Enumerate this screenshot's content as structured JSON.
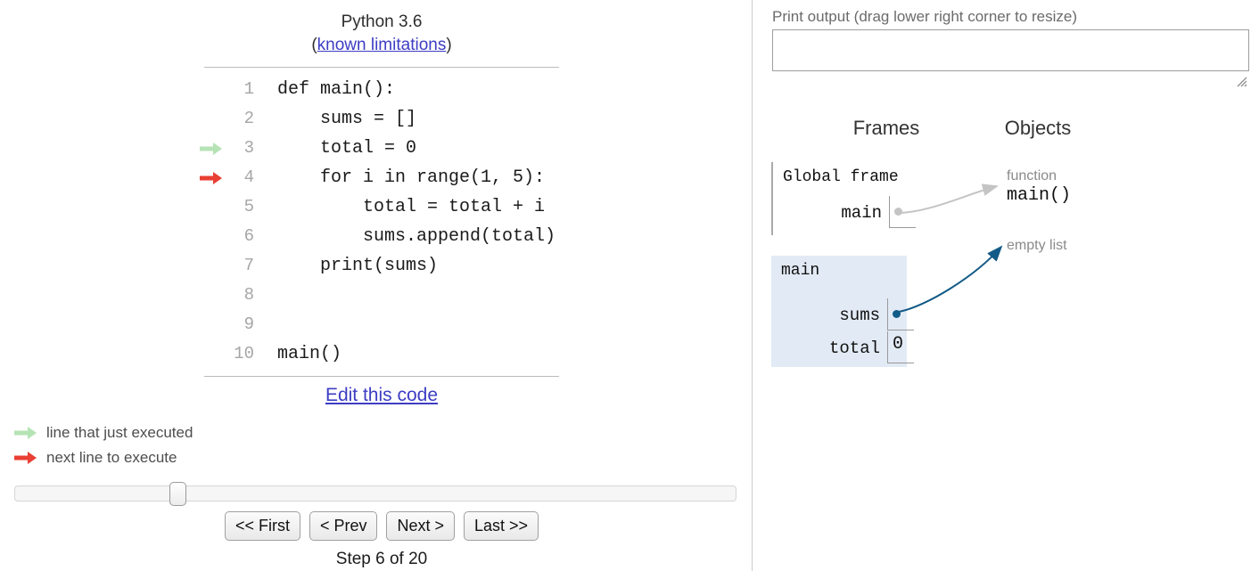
{
  "left": {
    "python_version": "Python 3.6",
    "known_limitations_prefix": "(",
    "known_limitations_link": "known limitations",
    "known_limitations_suffix": ")",
    "code_lines": [
      {
        "num": "1",
        "text": "def main():",
        "marker": "none"
      },
      {
        "num": "2",
        "text": "    sums = []",
        "marker": "none"
      },
      {
        "num": "3",
        "text": "    total = 0",
        "marker": "green"
      },
      {
        "num": "4",
        "text": "    for i in range(1, 5):",
        "marker": "red"
      },
      {
        "num": "5",
        "text": "        total = total + i",
        "marker": "none"
      },
      {
        "num": "6",
        "text": "        sums.append(total)",
        "marker": "none"
      },
      {
        "num": "7",
        "text": "    print(sums)",
        "marker": "none"
      },
      {
        "num": "8",
        "text": "",
        "marker": "none"
      },
      {
        "num": "9",
        "text": "",
        "marker": "none"
      },
      {
        "num": "10",
        "text": "main()",
        "marker": "none"
      }
    ],
    "edit_link": "Edit this code",
    "legend": [
      {
        "icon": "green-arrow-icon",
        "label": "line that just executed"
      },
      {
        "icon": "red-arrow-icon",
        "label": "next line to execute"
      }
    ],
    "nav_buttons": [
      {
        "name": "first",
        "label": "<< First"
      },
      {
        "name": "prev",
        "label": "< Prev"
      },
      {
        "name": "next",
        "label": "Next >"
      },
      {
        "name": "last",
        "label": "Last >>"
      }
    ],
    "step_label": "Step 6 of 20",
    "slider": {
      "value": 6,
      "min": 1,
      "max": 20,
      "percent": 22
    }
  },
  "right": {
    "print_output_label": "Print output (drag lower right corner to resize)",
    "print_output_value": "",
    "frames_header": "Frames",
    "objects_header": "Objects",
    "frames": [
      {
        "title": "Global frame",
        "highlighted": false,
        "vars": [
          {
            "name": "main",
            "value": "",
            "is_pointer": true
          }
        ]
      },
      {
        "title": "main",
        "highlighted": true,
        "vars": [
          {
            "name": "sums",
            "value": "",
            "is_pointer": true
          },
          {
            "name": "total",
            "value": "0",
            "is_pointer": false
          }
        ]
      }
    ],
    "objects": [
      {
        "type_label": "function",
        "value_label": "main()"
      },
      {
        "type_label": "empty list",
        "value_label": ""
      }
    ]
  },
  "colors": {
    "green_arrow": "#b5e3b5",
    "red_arrow": "#e93f34",
    "link": "#3d3dc4",
    "frame_highlight": "#e2eaf5",
    "pointer_blue": "#125a87",
    "pointer_gray": "#c4c4c4",
    "divider": "#cccccc",
    "heap_label_gray": "#8a8a8a"
  }
}
